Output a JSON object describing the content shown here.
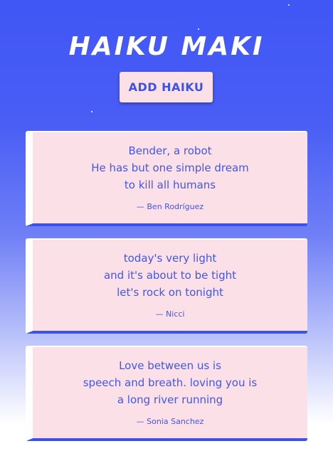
{
  "app": {
    "title": "HAIKU MAKI",
    "add_button_label": "ADD HAIKU"
  },
  "haikus": [
    {
      "lines": [
        "Bender, a robot",
        "He has but one simple dream",
        "to kill all humans"
      ],
      "author": "— Ben Rodríguez"
    },
    {
      "lines": [
        "today's very light",
        "and it's about to be tight",
        "let's rock on tonight"
      ],
      "author": "— Nicci"
    },
    {
      "lines": [
        "Love between us is",
        "speech and breath. loving you is",
        "a long river running"
      ],
      "author": "— Sonia Sanchez"
    }
  ],
  "colors": {
    "accent": "#3d53e8",
    "card_background": "#fbe0e8",
    "header_background": "#4056f5"
  }
}
